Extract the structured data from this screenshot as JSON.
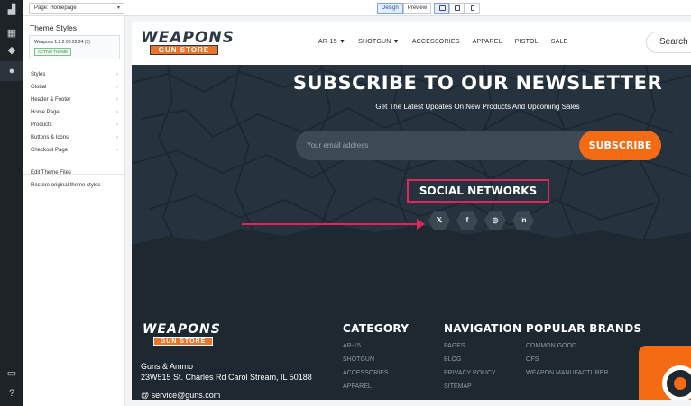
{
  "toolbar": {
    "page_select": "Page: Homepage",
    "design_label": "Design",
    "preview_label": "Preview"
  },
  "sidebar": {
    "title": "Theme Styles",
    "theme_name": "Weapons 1.2.2 08.29.24 (3)",
    "active_badge": "ACTIVE THEME",
    "items": [
      {
        "label": "Styles"
      },
      {
        "label": "Global"
      },
      {
        "label": "Header & Footer"
      },
      {
        "label": "Home Page"
      },
      {
        "label": "Products"
      },
      {
        "label": "Buttons & Icons"
      },
      {
        "label": "Checkout Page"
      }
    ],
    "links": [
      "Edit Theme Files",
      "Restore original theme styles"
    ]
  },
  "site": {
    "logo_top": "WEAPONS",
    "logo_bottom": "GUN STORE",
    "nav": [
      "AR-15 ▼",
      "SHOTGUN ▼",
      "ACCESSORIES",
      "APPAREL",
      "PISTOL",
      "SALE"
    ],
    "search_placeholder": "Search",
    "newsletter_title": "SUBSCRIBE TO OUR NEWSLETTER",
    "newsletter_sub": "Get The Latest Updates On New Products And Upcoming Sales",
    "email_placeholder": "Your email address",
    "subscribe_label": "SUBSCRIBE",
    "social_title": "SOCIAL NETWORKS",
    "social": [
      "𝕏",
      "f",
      "◎",
      "in"
    ]
  },
  "footer": {
    "address_line1": "Guns & Ammo",
    "address_line2": "23W515 St. Charles Rd Carol Stream, IL 50188",
    "email": "@ service@guns.com",
    "columns": [
      {
        "title": "CATEGORY",
        "links": [
          "AR-15",
          "SHOTGUN",
          "ACCESSORIES",
          "APPAREL"
        ]
      },
      {
        "title": "NAVIGATION",
        "links": [
          "PAGES",
          "BLOG",
          "PRIVACY POLICY",
          "SITEMAP"
        ]
      },
      {
        "title": "POPULAR BRANDS",
        "links": [
          "COMMON GOOD",
          "OFS",
          "WEAPON MANUFACTURER"
        ]
      }
    ]
  },
  "colors": {
    "accent": "#f46b13",
    "highlight": "#e0245e",
    "dark": "#26333f"
  }
}
